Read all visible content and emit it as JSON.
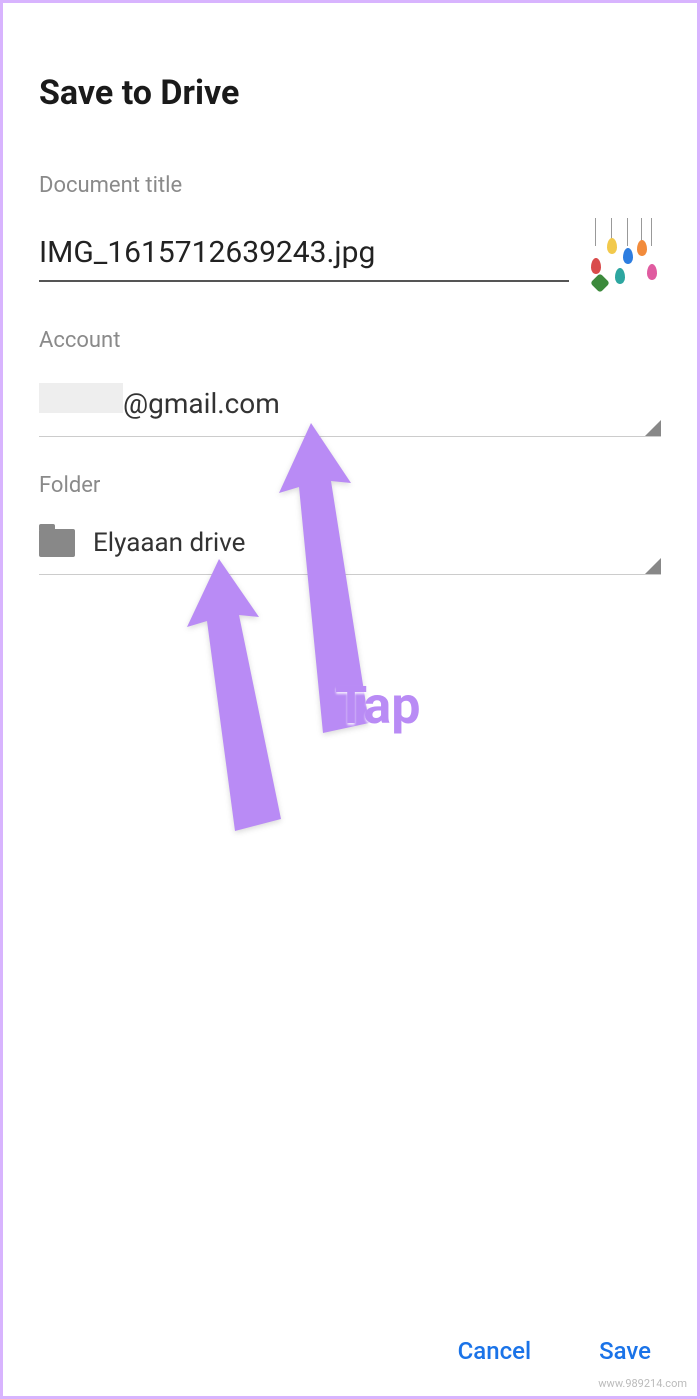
{
  "dialog": {
    "title": "Save to Drive",
    "document_title_label": "Document title",
    "document_title_value": "IMG_1615712639243.jpg",
    "account_label": "Account",
    "account_value_suffix": "@gmail.com",
    "folder_label": "Folder",
    "folder_value": "Elyaaan drive"
  },
  "buttons": {
    "cancel": "Cancel",
    "save": "Save"
  },
  "annotation": {
    "tap": "Tap"
  },
  "watermark": "www.989214.com"
}
